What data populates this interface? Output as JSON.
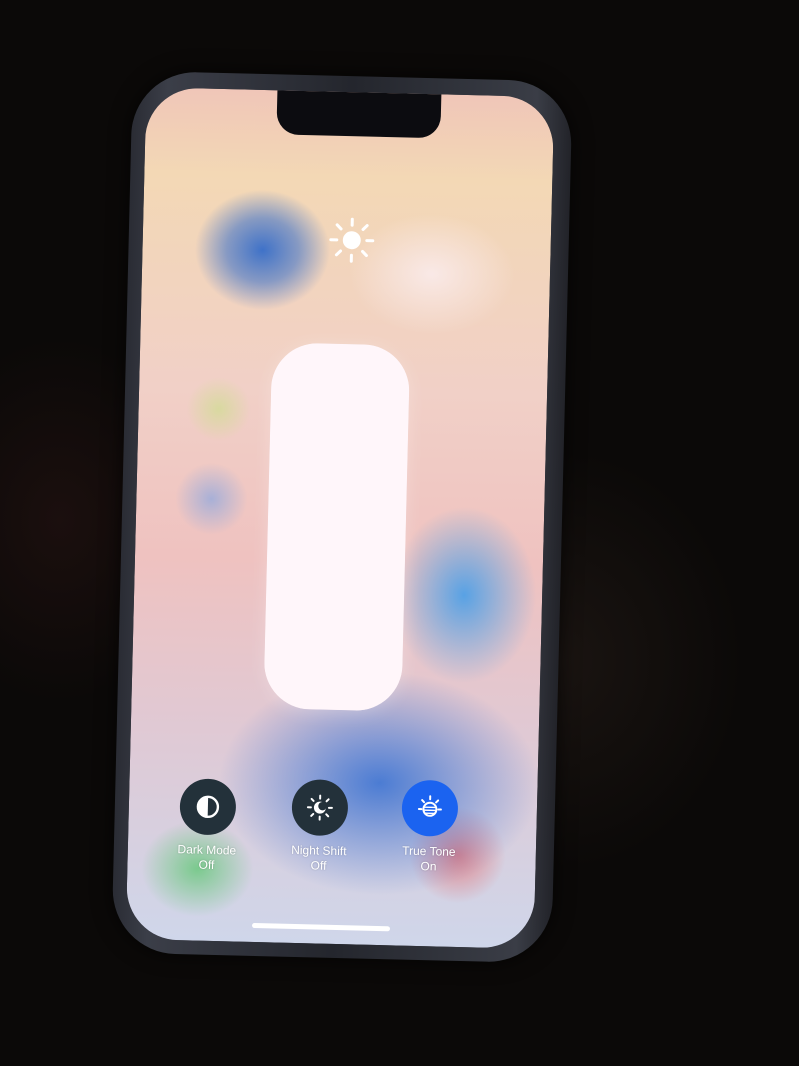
{
  "brightness": {
    "icon": "sun-icon",
    "level_percent": 100
  },
  "display_toggles": [
    {
      "icon": "dark-mode-icon",
      "label": "Dark Mode",
      "status": "Off",
      "active": false
    },
    {
      "icon": "night-shift-icon",
      "label": "Night Shift",
      "status": "Off",
      "active": false
    },
    {
      "icon": "true-tone-icon",
      "label": "True Tone",
      "status": "On",
      "active": true
    }
  ],
  "colors": {
    "toggle_off": "#23313a",
    "toggle_on": "#1b63f0",
    "slider": "#f6e8ec"
  }
}
